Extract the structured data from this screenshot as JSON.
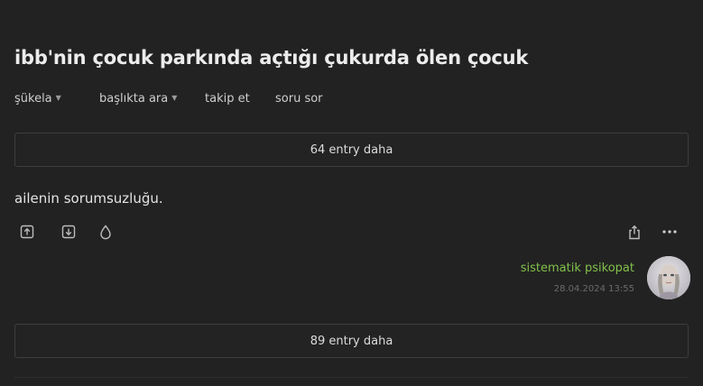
{
  "topic": {
    "title": "ibb'nin çocuk parkında açtığı çukurda ölen çocuk"
  },
  "topic_nav": {
    "sort_label": "şükela",
    "search_label": "başlıkta ara",
    "follow_label": "takip et",
    "ask_label": "soru sor"
  },
  "more_entries_top": {
    "label": "64 entry daha"
  },
  "entry": {
    "content": "ailenin sorumsuzluğu.",
    "author": "sistematik psikopat",
    "date": "28.04.2024 13:55",
    "actions": [
      {
        "name": "upvote",
        "icon": "arrow-up-box-icon"
      },
      {
        "name": "downvote",
        "icon": "arrow-down-box-icon"
      },
      {
        "name": "favorite",
        "icon": "drop-icon"
      },
      {
        "name": "share",
        "icon": "share-icon"
      },
      {
        "name": "more",
        "icon": "ellipsis-icon"
      }
    ]
  },
  "more_entries_bottom": {
    "label": "89 entry daha"
  },
  "colors": {
    "background": "#222222",
    "author_green": "#81c14b",
    "text": "#e4e4e4",
    "muted": "#6c6c6c"
  }
}
